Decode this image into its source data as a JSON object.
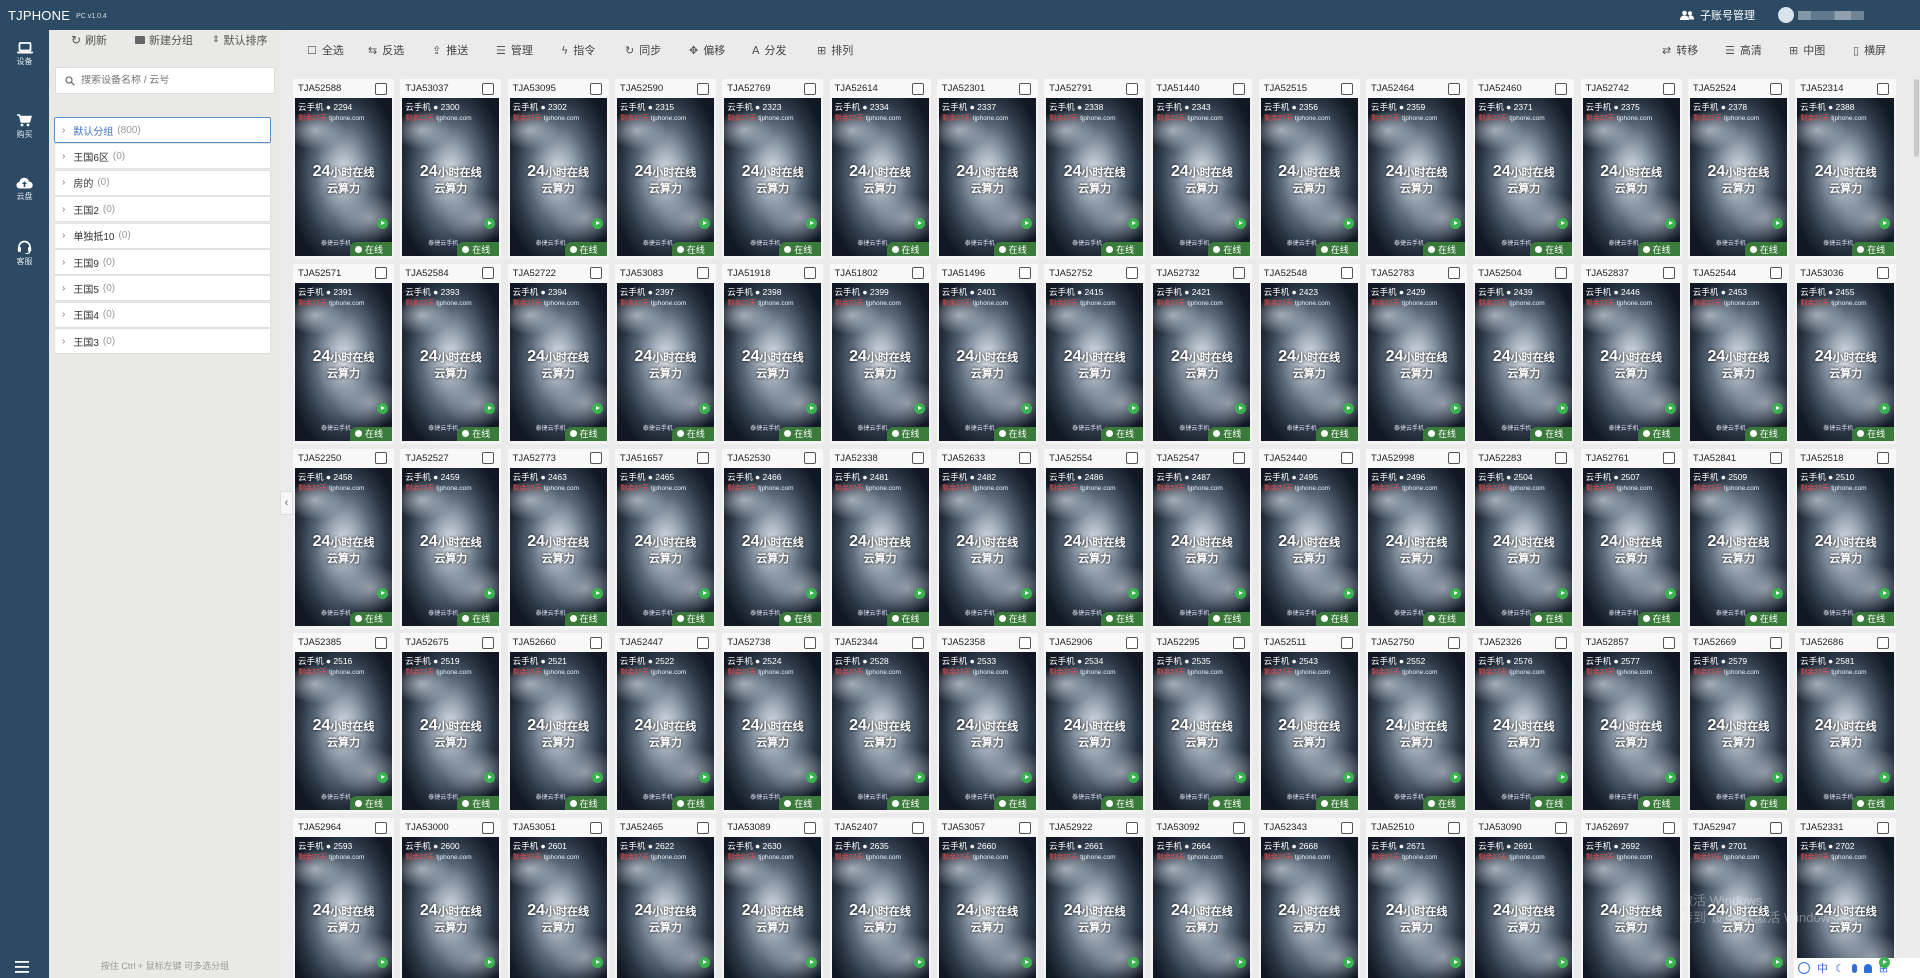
{
  "titlebar": {
    "app_name": "TJPHONE",
    "version": "PC v1.0.4",
    "subaccount_label": "子账号管理"
  },
  "leftnav": {
    "items": [
      {
        "label": "设备",
        "icon": "laptop-icon"
      },
      {
        "label": "购买",
        "icon": "cart-icon"
      },
      {
        "label": "云盘",
        "icon": "cloud-upload-icon"
      },
      {
        "label": "客服",
        "icon": "headset-icon"
      }
    ]
  },
  "sidebar": {
    "refresh_label": "刷新",
    "new_group_label": "新建分组",
    "sort_label": "默认排序",
    "search_placeholder": "搜索设备名称 / 云号",
    "groups": [
      {
        "name": "默认分组",
        "count": "(800)"
      },
      {
        "name": "王国6区",
        "count": "(0)"
      },
      {
        "name": "房的",
        "count": "(0)"
      },
      {
        "name": "王国2",
        "count": "(0)"
      },
      {
        "name": "单独抵10",
        "count": "(0)"
      },
      {
        "name": "王国9",
        "count": "(0)"
      },
      {
        "name": "王国5",
        "count": "(0)"
      },
      {
        "name": "王国4",
        "count": "(0)"
      },
      {
        "name": "王国3",
        "count": "(0)"
      }
    ],
    "hint": "按住 Ctrl + 鼠标左键 可多选分组"
  },
  "toolbar": {
    "left": [
      {
        "label": "全选",
        "icon": "checkbox-icon"
      },
      {
        "label": "反选",
        "icon": "invert-icon"
      },
      {
        "label": "推送",
        "icon": "upload-icon"
      },
      {
        "label": "管理",
        "icon": "list-icon"
      },
      {
        "label": "指令",
        "icon": "bolt-icon"
      },
      {
        "label": "同步",
        "icon": "sync-icon"
      },
      {
        "label": "偏移",
        "icon": "move-icon"
      },
      {
        "label": "分发",
        "icon": "font-icon"
      },
      {
        "label": "排列",
        "icon": "grid-icon"
      }
    ],
    "right": [
      {
        "label": "转移",
        "icon": "transfer-icon"
      },
      {
        "label": "高清",
        "icon": "hd-icon"
      },
      {
        "label": "中图",
        "icon": "medium-grid-icon"
      },
      {
        "label": "横屏",
        "icon": "phone-icon"
      }
    ]
  },
  "device_template": {
    "promo": "剩余27天",
    "site": "tjphone.com",
    "line1_big": "24",
    "line1_rest": "小时在线",
    "line2": "云算力",
    "brand": "泰捷云手机",
    "status": "在线",
    "id_prefix": "云手机 ● "
  },
  "devices": [
    [
      "TJA52588",
      "2294"
    ],
    [
      "TJA53037",
      "2300"
    ],
    [
      "TJA53095",
      "2302"
    ],
    [
      "TJA52590",
      "2315"
    ],
    [
      "TJA52769",
      "2323"
    ],
    [
      "TJA52614",
      "2334"
    ],
    [
      "TJA52301",
      "2337"
    ],
    [
      "TJA52791",
      "2338"
    ],
    [
      "TJA51440",
      "2343"
    ],
    [
      "TJA52515",
      "2356"
    ],
    [
      "TJA52464",
      "2359"
    ],
    [
      "TJA52460",
      "2371"
    ],
    [
      "TJA52742",
      "2375"
    ],
    [
      "TJA52524",
      "2378"
    ],
    [
      "TJA52314",
      "2388"
    ],
    [
      "TJA52571",
      "2391"
    ],
    [
      "TJA52584",
      "2393"
    ],
    [
      "TJA52722",
      "2394"
    ],
    [
      "TJA53083",
      "2397"
    ],
    [
      "TJA51918",
      "2398"
    ],
    [
      "TJA51802",
      "2399"
    ],
    [
      "TJA51496",
      "2401"
    ],
    [
      "TJA52752",
      "2415"
    ],
    [
      "TJA52732",
      "2421"
    ],
    [
      "TJA52548",
      "2423"
    ],
    [
      "TJA52783",
      "2429"
    ],
    [
      "TJA52504",
      "2439"
    ],
    [
      "TJA52837",
      "2446"
    ],
    [
      "TJA52544",
      "2453"
    ],
    [
      "TJA53036",
      "2455"
    ],
    [
      "TJA52250",
      "2458"
    ],
    [
      "TJA52527",
      "2459"
    ],
    [
      "TJA52773",
      "2463"
    ],
    [
      "TJA51657",
      "2465"
    ],
    [
      "TJA52530",
      "2466"
    ],
    [
      "TJA52338",
      "2481"
    ],
    [
      "TJA52633",
      "2482"
    ],
    [
      "TJA52554",
      "2486"
    ],
    [
      "TJA52547",
      "2487"
    ],
    [
      "TJA52440",
      "2495"
    ],
    [
      "TJA52998",
      "2496"
    ],
    [
      "TJA52283",
      "2504"
    ],
    [
      "TJA52761",
      "2507"
    ],
    [
      "TJA52841",
      "2509"
    ],
    [
      "TJA52518",
      "2510"
    ],
    [
      "TJA52385",
      "2516"
    ],
    [
      "TJA52675",
      "2519"
    ],
    [
      "TJA52660",
      "2521"
    ],
    [
      "TJA52447",
      "2522"
    ],
    [
      "TJA52738",
      "2524"
    ],
    [
      "TJA52344",
      "2528"
    ],
    [
      "TJA52358",
      "2533"
    ],
    [
      "TJA52906",
      "2534"
    ],
    [
      "TJA52295",
      "2535"
    ],
    [
      "TJA52511",
      "2543"
    ],
    [
      "TJA52750",
      "2552"
    ],
    [
      "TJA52326",
      "2576"
    ],
    [
      "TJA52857",
      "2577"
    ],
    [
      "TJA52669",
      "2579"
    ],
    [
      "TJA52686",
      "2581"
    ],
    [
      "TJA52964",
      "2593"
    ],
    [
      "TJA53000",
      "2600"
    ],
    [
      "TJA53051",
      "2601"
    ],
    [
      "TJA52465",
      "2622"
    ],
    [
      "TJA53089",
      "2630"
    ],
    [
      "TJA52407",
      "2635"
    ],
    [
      "TJA53057",
      "2660"
    ],
    [
      "TJA52922",
      "2661"
    ],
    [
      "TJA53092",
      "2664"
    ],
    [
      "TJA52343",
      "2668"
    ],
    [
      "TJA52510",
      "2671"
    ],
    [
      "TJA53090",
      "2691"
    ],
    [
      "TJA52697",
      "2692"
    ],
    [
      "TJA52947",
      "2701"
    ],
    [
      "TJA52331",
      "2702"
    ]
  ],
  "watermark": {
    "line1": "激活 Windows",
    "line2": "转到\"设置\"以激活 Windows。"
  },
  "ime": {
    "mode": "中"
  }
}
